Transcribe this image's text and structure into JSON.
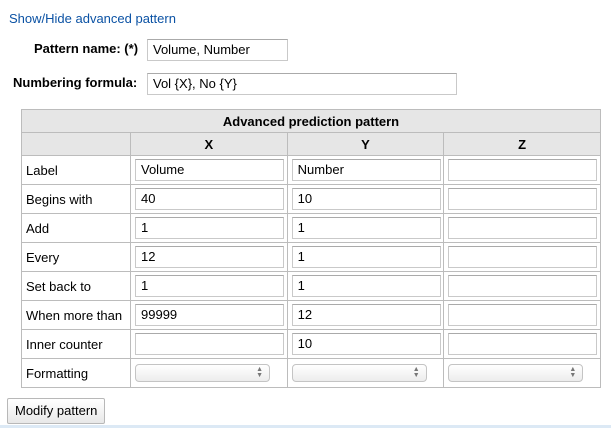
{
  "toggle_link": "Show/Hide advanced pattern",
  "pattern_name": {
    "label": "Pattern name: (*)",
    "value": "Volume, Number"
  },
  "numbering_formula": {
    "label": "Numbering formula:",
    "value": "Vol {X}, No {Y}"
  },
  "table": {
    "title": "Advanced prediction pattern",
    "columns": [
      "X",
      "Y",
      "Z"
    ],
    "rows": [
      {
        "label": "Label",
        "x": "Volume",
        "y": "Number",
        "z": ""
      },
      {
        "label": "Begins with",
        "x": "40",
        "y": "10",
        "z": ""
      },
      {
        "label": "Add",
        "x": "1",
        "y": "1",
        "z": ""
      },
      {
        "label": "Every",
        "x": "12",
        "y": "1",
        "z": ""
      },
      {
        "label": "Set back to",
        "x": "1",
        "y": "1",
        "z": ""
      },
      {
        "label": "When more than",
        "x": "99999",
        "y": "12",
        "z": ""
      },
      {
        "label": "Inner counter",
        "x": "",
        "y": "10",
        "z": ""
      },
      {
        "label": "Formatting",
        "x": "",
        "y": "",
        "z": ""
      }
    ]
  },
  "modify_button": "Modify pattern"
}
